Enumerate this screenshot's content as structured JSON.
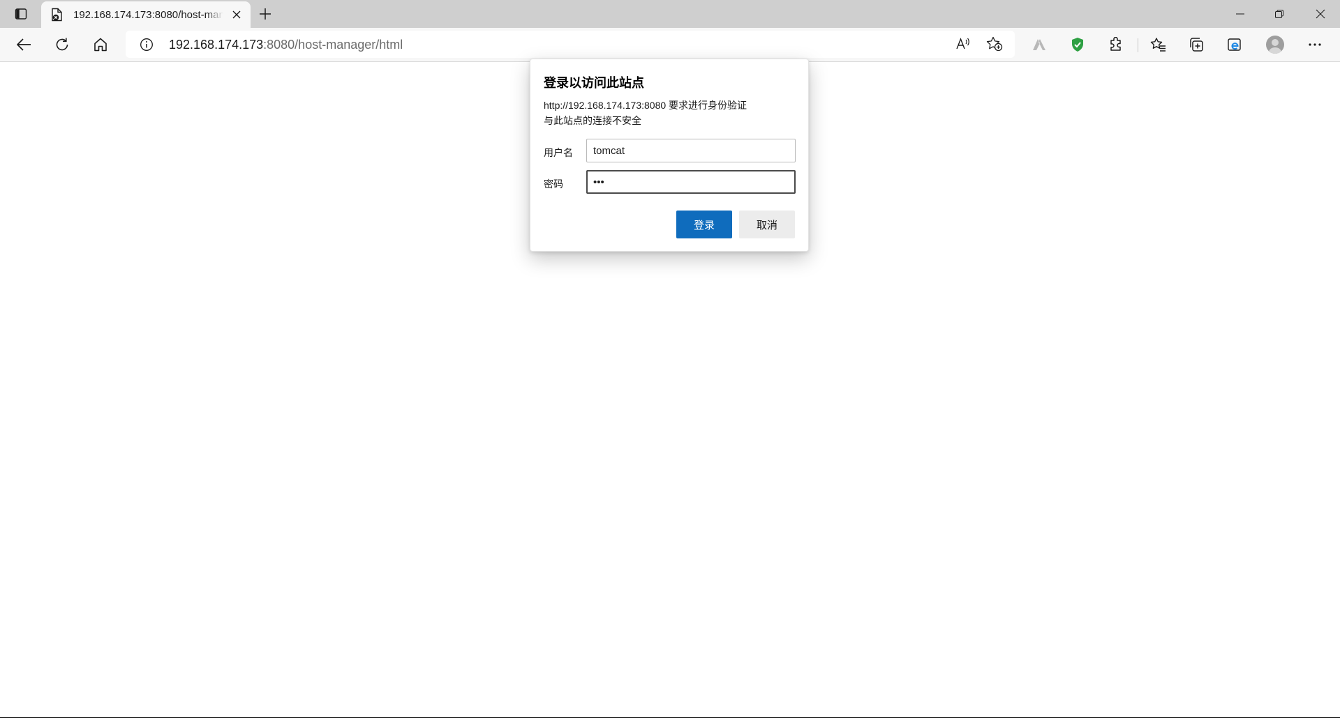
{
  "browser": {
    "tab": {
      "title": "192.168.174.173:8080/host-manager/html"
    },
    "address_bar": {
      "host": "192.168.174.173",
      "rest": ":8080/host-manager/html"
    },
    "icons": {
      "tab_actions": "tab-actions-icon",
      "favicon": "page-error-icon",
      "close_tab": "close-icon",
      "new_tab": "plus-icon",
      "back": "back-arrow-icon",
      "refresh": "refresh-icon",
      "home": "home-icon",
      "site_info": "info-icon",
      "read_aloud": "read-aloud-icon",
      "add_favorite": "star-plus-icon",
      "browser_extension": "extension-a-icon",
      "shield_extension": "shield-icon",
      "extensions": "puzzle-icon",
      "favorites": "favorites-icon",
      "collections": "collections-icon",
      "ie_mode": "ie-mode-icon",
      "profile": "profile-avatar",
      "menu": "more-icon"
    },
    "accent_color": "#0f6cbd",
    "shield_color": "#2ea043"
  },
  "dialog": {
    "title": "登录以访问此站点",
    "message_line1": "http://192.168.174.173:8080 要求进行身份验证",
    "message_line2": "与此站点的连接不安全",
    "username_label": "用户名",
    "username_value": "tomcat",
    "password_label": "密码",
    "password_value": "•••",
    "login_button": "登录",
    "cancel_button": "取消"
  }
}
